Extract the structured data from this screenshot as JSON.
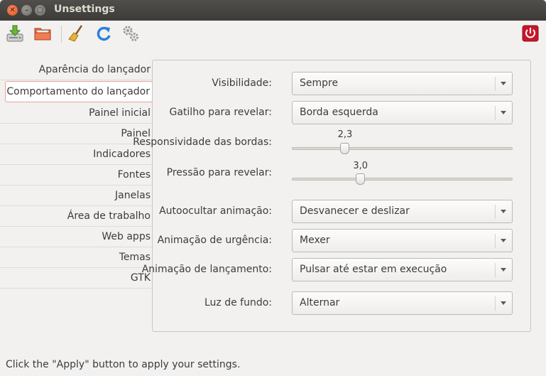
{
  "window": {
    "title": "Unsettings"
  },
  "titlebar": {
    "close_glyph": "✕",
    "minimize_glyph": "–",
    "maximize_glyph": "▢"
  },
  "toolbar": {
    "buttons": [
      {
        "icon": "save-icon"
      },
      {
        "icon": "open-folder-icon"
      },
      {
        "icon": "broom-icon"
      },
      {
        "icon": "refresh-icon"
      },
      {
        "icon": "gears-icon"
      },
      {
        "icon": "power-icon"
      }
    ]
  },
  "sidebar": {
    "items": [
      {
        "label": "Aparência do lançador"
      },
      {
        "label": "Comportamento do lançador",
        "selected": true
      },
      {
        "label": "Painel inicial"
      },
      {
        "label": "Painel"
      },
      {
        "label": "Indicadores"
      },
      {
        "label": "Fontes"
      },
      {
        "label": "Janelas"
      },
      {
        "label": "Área de trabalho"
      },
      {
        "label": "Web apps"
      },
      {
        "label": "Temas"
      },
      {
        "label": "GTK"
      }
    ]
  },
  "settings": {
    "visibility": {
      "label": "Visibilidade:",
      "value": "Sempre"
    },
    "reveal_trigger": {
      "label": "Gatilho para revelar:",
      "value": "Borda esquerda"
    },
    "edge_responsiveness": {
      "label": "Responsividade das bordas:",
      "value_text": "2,3",
      "fraction": 0.24
    },
    "reveal_pressure": {
      "label": "Pressão para revelar:",
      "value_text": "3,0",
      "fraction": 0.31
    },
    "autohide_animation": {
      "label": "Autoocultar animação:",
      "value": "Desvanecer e deslizar"
    },
    "urgency_animation": {
      "label": "Animação de urgência:",
      "value": "Mexer"
    },
    "launch_animation": {
      "label": "Animação de lançamento:",
      "value": "Pulsar até estar em execução"
    },
    "backlight": {
      "label": "Luz de fundo:",
      "value": "Alternar"
    }
  },
  "status": {
    "text": "Click the \"Apply\" button to apply your settings."
  },
  "colors": {
    "titlebar": "#3c3b37",
    "close_button": "#e2521d",
    "selection_border": "#e8a59a",
    "power_button": "#c7162b"
  }
}
